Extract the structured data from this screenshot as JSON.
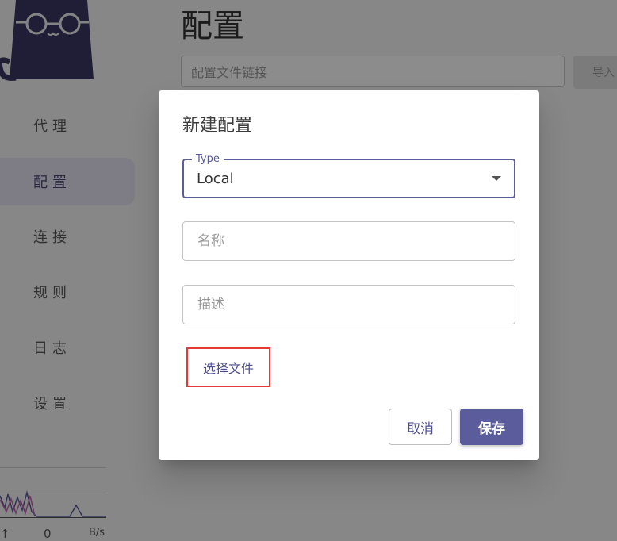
{
  "background": {
    "page_title": "配置",
    "url_input_placeholder": "配置文件链接",
    "import_label": "导入",
    "nav": [
      {
        "label": "代理"
      },
      {
        "label": "配置"
      },
      {
        "label": "连接"
      },
      {
        "label": "规则"
      },
      {
        "label": "日志"
      },
      {
        "label": "设置"
      }
    ],
    "traffic": {
      "value": "0",
      "unit": "B/s"
    }
  },
  "dialog": {
    "title": "新建配置",
    "type_field": {
      "legend": "Type",
      "value": "Local"
    },
    "name_placeholder": "名称",
    "desc_placeholder": "描述",
    "choose_file_label": "选择文件",
    "cancel_label": "取消",
    "save_label": "保存"
  },
  "colors": {
    "accent": "#5b5c9b",
    "highlight": "#e53935"
  }
}
